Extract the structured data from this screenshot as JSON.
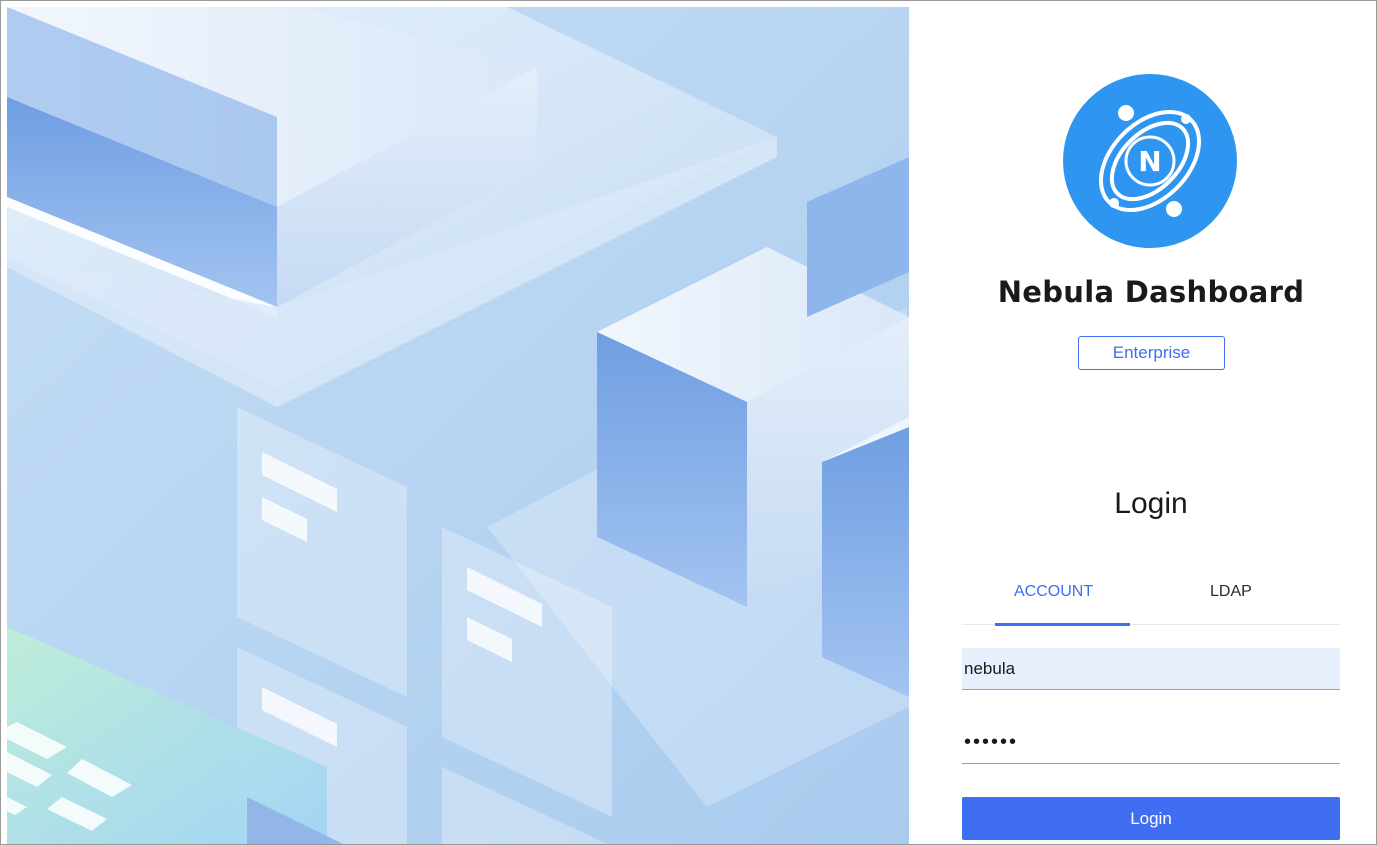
{
  "app": {
    "title": "Nebula Dashboard",
    "edition": "Enterprise",
    "logo_letter": "N"
  },
  "login": {
    "heading": "Login",
    "tabs": [
      {
        "label": "ACCOUNT",
        "active": true
      },
      {
        "label": "LDAP",
        "active": false
      }
    ],
    "username_value": "nebula",
    "password_value": "••••••",
    "submit_label": "Login"
  },
  "colors": {
    "accent": "#3f6ef2",
    "logo_blue": "#2e95f0",
    "autofill_bg": "#e8f0fe",
    "hero_bg": "#b8d6f2"
  },
  "icons": {
    "logo": "nebula-orbit-logo-icon"
  }
}
